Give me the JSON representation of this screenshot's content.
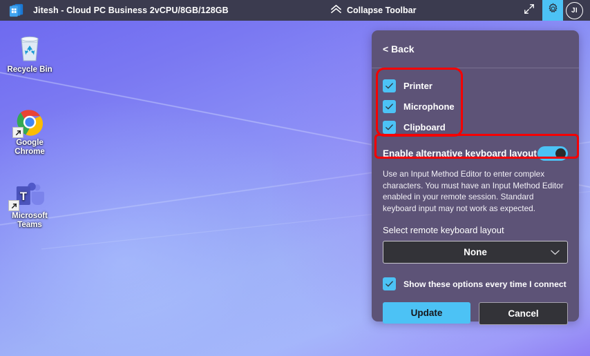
{
  "toolbar": {
    "logo_icon": "cloud-pc-windows-icon",
    "title": "Jitesh - Cloud PC Business 2vCPU/8GB/128GB",
    "collapse_label": "Collapse Toolbar",
    "collapse_icon": "double-chevron-up-icon",
    "fullscreen_icon": "expand-diagonal-arrows-icon",
    "settings_icon": "gear-icon",
    "avatar_initials": "JI",
    "background_color": "#3b3b4f",
    "accent_color": "#4cc2f5"
  },
  "desktop": {
    "icons": [
      {
        "name": "Recycle Bin",
        "icon": "recycle-bin-icon",
        "shortcut": false
      },
      {
        "name": "Google Chrome",
        "icon": "google-chrome-icon",
        "shortcut": true,
        "shortcut_glyph": "↗"
      },
      {
        "name": "Microsoft Teams",
        "icon": "microsoft-teams-icon",
        "shortcut": true,
        "shortcut_glyph": "↗"
      }
    ]
  },
  "panel": {
    "back_label": "< Back",
    "devices": [
      {
        "label": "Printer",
        "checked": true
      },
      {
        "label": "Microphone",
        "checked": true
      },
      {
        "label": "Clipboard",
        "checked": true
      }
    ],
    "keyboard_toggle": {
      "label": "Enable alternative keyboard layout",
      "enabled": true
    },
    "description": "Use an Input Method Editor to enter complex characters. You must have an Input Method Editor enabled in your remote session. Standard keyboard input may not work as expected.",
    "layout_section_label": "Select remote keyboard layout",
    "layout_dropdown": {
      "value": "None",
      "chevron_icon": "chevron-down-icon"
    },
    "show_options": {
      "label": "Show these options every time I connect",
      "checked": true
    },
    "buttons": {
      "update": "Update",
      "cancel": "Cancel"
    },
    "background_color": "#5d5377"
  },
  "annotations": {
    "devices_highlight_color": "#f50000",
    "keyboard_highlight_color": "#f50000"
  }
}
